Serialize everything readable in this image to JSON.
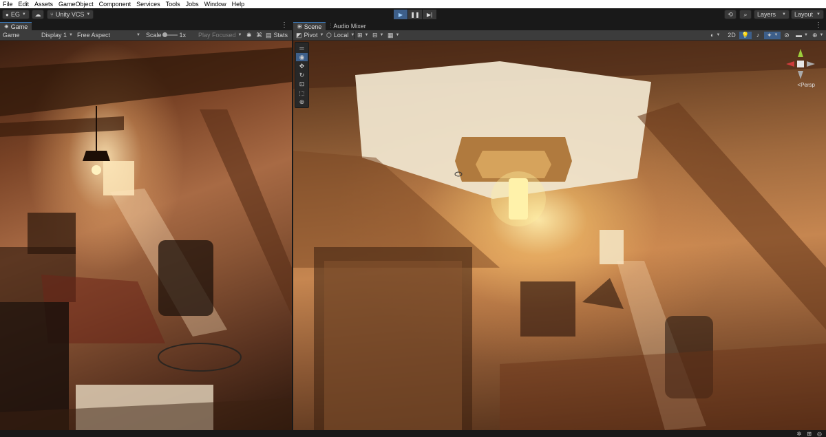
{
  "menu": [
    "File",
    "Edit",
    "Assets",
    "GameObject",
    "Component",
    "Services",
    "Tools",
    "Jobs",
    "Window",
    "Help"
  ],
  "toolbar": {
    "account_label": "EG",
    "vcs_label": "Unity VCS",
    "layers_label": "Layers",
    "layout_label": "Layout"
  },
  "game_panel": {
    "tab_label": "Game",
    "mode_label": "Game",
    "display_label": "Display 1",
    "aspect_label": "Free Aspect",
    "scale_label": "Scale",
    "scale_value": "1x",
    "play_focused_label": "Play Focused",
    "stats_label": "Stats"
  },
  "scene_panel": {
    "tabs": [
      "Scene",
      "Audio Mixer"
    ],
    "pivot_label": "Pivot",
    "local_label": "Local",
    "mode_2d": "2D",
    "persp_label": "<Persp"
  },
  "colors": {
    "accent": "#3a79bb",
    "play_active": "#3d5f8a",
    "panel_bg": "#282828",
    "toolbar_bg": "#191919"
  },
  "icons": {
    "play": "play-icon",
    "pause": "pause-icon",
    "step": "step-icon",
    "history": "history-icon",
    "search": "search-icon"
  }
}
